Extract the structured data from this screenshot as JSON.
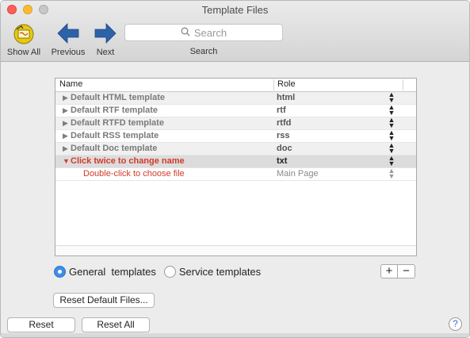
{
  "window": {
    "title": "Template Files"
  },
  "toolbar": {
    "show_all": "Show All",
    "previous": "Previous",
    "next": "Next",
    "search_placeholder": "Search",
    "search_caption": "Search"
  },
  "table": {
    "headers": {
      "name": "Name",
      "role": "Role"
    },
    "rows": [
      {
        "name": "Default HTML template",
        "role": "html"
      },
      {
        "name": "Default RTF template",
        "role": "rtf"
      },
      {
        "name": "Default RTFD template",
        "role": "rtfd"
      },
      {
        "name": "Default RSS template",
        "role": "rss"
      },
      {
        "name": "Default Doc template",
        "role": "doc"
      },
      {
        "name": "Click twice to change name",
        "role": "txt"
      }
    ],
    "child": {
      "name": "Double-click to choose file",
      "role": "Main Page"
    }
  },
  "template_type": {
    "general_label": "General  templates",
    "service_label": "Service templates",
    "selected": "general"
  },
  "buttons": {
    "plus": "+",
    "minus": "−",
    "reset_default_files": "Reset Default Files...",
    "reset": "Reset",
    "reset_all": "Reset All",
    "help": "?"
  },
  "colors": {
    "accent": "#3d8ee8",
    "selected_text": "#d23a2a",
    "arrow_blue": "#2c62a8"
  },
  "icons": {
    "show_all": "notes-icon",
    "previous": "left-arrow-icon",
    "next": "right-arrow-icon",
    "search": "search-icon",
    "expand": "disclosure-triangle-icon",
    "stepper": "stepper-icon",
    "help": "help-icon"
  }
}
